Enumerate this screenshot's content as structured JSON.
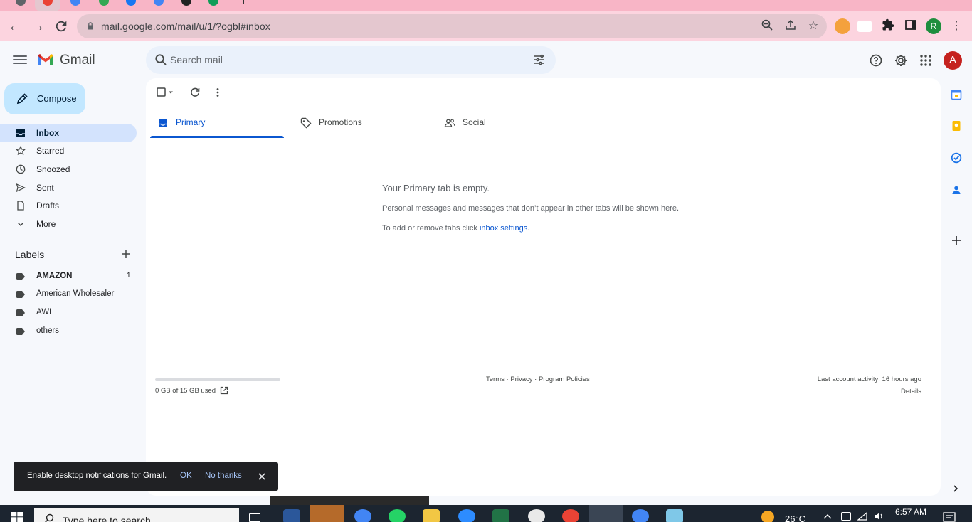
{
  "browser": {
    "url": "mail.google.com/mail/u/1/?ogbl#inbox",
    "profile_initial": "R"
  },
  "app": {
    "name": "Gmail",
    "account_initial": "A"
  },
  "search": {
    "placeholder": "Search mail"
  },
  "compose": {
    "label": "Compose"
  },
  "nav": {
    "items": [
      {
        "label": "Inbox"
      },
      {
        "label": "Starred"
      },
      {
        "label": "Snoozed"
      },
      {
        "label": "Sent"
      },
      {
        "label": "Drafts"
      },
      {
        "label": "More"
      }
    ]
  },
  "labels": {
    "title": "Labels",
    "items": [
      {
        "label": "AMAZON",
        "count": "1"
      },
      {
        "label": "American Wholesaler"
      },
      {
        "label": "AWL"
      },
      {
        "label": "others"
      }
    ]
  },
  "tabs": [
    {
      "label": "Primary"
    },
    {
      "label": "Promotions"
    },
    {
      "label": "Social"
    }
  ],
  "empty_state": {
    "title": "Your Primary tab is empty.",
    "description": "Personal messages and messages that don’t appear in other tabs will be shown here.",
    "hint_prefix": "To add or remove tabs click ",
    "hint_link": "inbox settings",
    "hint_suffix": "."
  },
  "footer": {
    "storage": "0 GB of 15 GB used",
    "storage_fraction": 0.0,
    "terms": "Terms",
    "privacy": "Privacy",
    "policies": "Program Policies",
    "sep": " · ",
    "activity": "Last account activity: 16 hours ago",
    "details": "Details"
  },
  "toast": {
    "message": "Enable desktop notifications for Gmail.",
    "ok": "OK",
    "no_thanks": "No thanks"
  },
  "taskbar": {
    "search_placeholder": "Type here to search",
    "temperature": "26°C",
    "time": "6:57 AM"
  },
  "colors": {
    "accent": "#0b57d0",
    "compose_bg": "#c2e7ff",
    "active_nav": "#d3e3fd",
    "avatar": "#c5221f",
    "tabstrip": "#f8b5c6"
  }
}
